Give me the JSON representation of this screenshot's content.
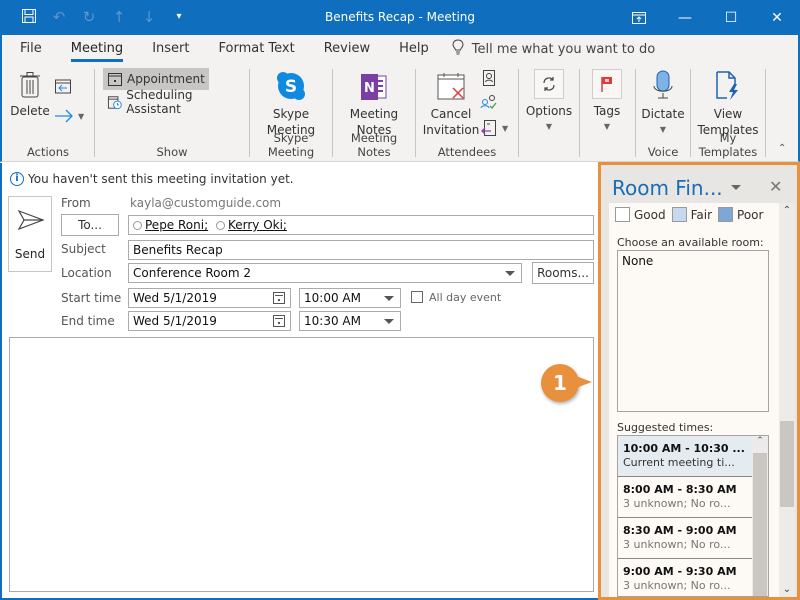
{
  "window": {
    "title": "Benefits Recap  -  Meeting",
    "controls": [
      "ribbon-display-options",
      "minimize",
      "maximize",
      "close"
    ]
  },
  "qat": {
    "icons": [
      "save-icon",
      "undo-icon",
      "redo-icon",
      "up-icon",
      "down-icon",
      "customize-icon"
    ]
  },
  "tabs": [
    {
      "label": "File",
      "active": false
    },
    {
      "label": "Meeting",
      "active": true
    },
    {
      "label": "Insert",
      "active": false
    },
    {
      "label": "Format Text",
      "active": false
    },
    {
      "label": "Review",
      "active": false
    },
    {
      "label": "Help",
      "active": false
    }
  ],
  "tell_me": "Tell me what you want to do",
  "ribbon": {
    "actions": {
      "label": "Actions",
      "delete": "Delete"
    },
    "show": {
      "label": "Show",
      "appointment": "Appointment",
      "scheduling": "Scheduling Assistant"
    },
    "skype": {
      "label": "Skype Meeting",
      "btn_line1": "Skype",
      "btn_line2": "Meeting"
    },
    "notes": {
      "label": "Meeting Notes",
      "btn_line1": "Meeting",
      "btn_line2": "Notes"
    },
    "attendees": {
      "label": "Attendees",
      "btn_line1": "Cancel",
      "btn_line2": "Invitation"
    },
    "options": {
      "label": "Options"
    },
    "tags": {
      "label": "Tags"
    },
    "voice": {
      "label": "Voice",
      "dictate": "Dictate"
    },
    "templates": {
      "label": "My Templates",
      "btn_line1": "View",
      "btn_line2": "Templates"
    }
  },
  "compose": {
    "info": "You haven't sent this meeting invitation yet.",
    "send": "Send",
    "from_label": "From",
    "from_value": "kayla@customguide.com",
    "to_button": "To...",
    "recipients": [
      "Pepe Roni;",
      "Kerry Oki;"
    ],
    "subject_label": "Subject",
    "subject_value": "Benefits Recap",
    "location_label": "Location",
    "location_value": "Conference Room 2",
    "rooms_button": "Rooms...",
    "start_label": "Start time",
    "start_date": "Wed 5/1/2019",
    "start_time": "10:00 AM",
    "end_label": "End time",
    "end_date": "Wed 5/1/2019",
    "end_time": "10:30 AM",
    "all_day_label": "All day event",
    "all_day_checked": false
  },
  "callout": {
    "number": "1",
    "color": "#e8903c"
  },
  "room_finder": {
    "title": "Room Fin...",
    "legend": [
      {
        "label": "Good",
        "color": "#ffffff"
      },
      {
        "label": "Fair",
        "color": "#c6d9f1"
      },
      {
        "label": "Poor",
        "color": "#7fa7d6"
      }
    ],
    "choose_label": "Choose an available room:",
    "rooms": [
      "None"
    ],
    "suggested_label": "Suggested times:",
    "suggested": [
      {
        "time": "10:00 AM - 10:30 ...",
        "detail": "Current meeting ti...",
        "current": true
      },
      {
        "time": "8:00 AM - 8:30 AM",
        "detail": "3 unknown; No ro...",
        "current": false
      },
      {
        "time": "8:30 AM - 9:00 AM",
        "detail": "3 unknown; No ro...",
        "current": false
      },
      {
        "time": "9:00 AM - 9:30 AM",
        "detail": "3 unknown; No ro...",
        "current": false
      }
    ]
  },
  "colors": {
    "brand": "#106ebe",
    "highlight": "#e8903c",
    "pane_title": "#1a6db4"
  }
}
